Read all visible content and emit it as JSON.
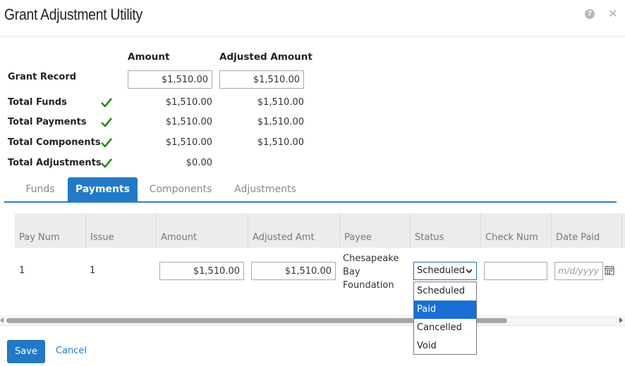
{
  "window": {
    "title": "Grant Adjustment Utility"
  },
  "summary": {
    "amount_header": "Amount",
    "adjusted_header": "Adjusted Amount",
    "grant_record_label": "Grant Record",
    "grant_record_amount": "$1,510.00",
    "grant_record_adjusted": "$1,510.00",
    "rows": [
      {
        "label": "Total Funds",
        "amount": "$1,510.00",
        "adjusted": "$1,510.00"
      },
      {
        "label": "Total Payments",
        "amount": "$1,510.00",
        "adjusted": "$1,510.00"
      },
      {
        "label": "Total Components",
        "amount": "$1,510.00",
        "adjusted": "$1,510.00"
      },
      {
        "label": "Total Adjustments",
        "amount": "$0.00",
        "adjusted": ""
      }
    ]
  },
  "tabs": [
    {
      "label": "Funds",
      "active": false
    },
    {
      "label": "Payments",
      "active": true
    },
    {
      "label": "Components",
      "active": false
    },
    {
      "label": "Adjustments",
      "active": false
    }
  ],
  "grid": {
    "columns": [
      "Pay Num",
      "Issue",
      "Amount",
      "Adjusted Amt",
      "Payee",
      "Status",
      "Check Num",
      "Date Paid"
    ],
    "row": {
      "pay_num": "1",
      "issue": "1",
      "amount": "$1,510.00",
      "adjusted_amt": "$1,510.00",
      "payee": [
        "Chesapeake",
        "Bay",
        "Foundation"
      ],
      "status": "Scheduled",
      "check_num": "",
      "date_placeholder": "m/d/yyyy"
    }
  },
  "status_options": [
    "Scheduled",
    "Paid",
    "Cancelled",
    "Void"
  ],
  "status_highlighted": "Paid",
  "footer": {
    "save_label": "Save",
    "cancel_label": "Cancel"
  },
  "colors": {
    "primary": "#2379c6",
    "check": "#2a8a1f",
    "highlight": "#1a6fd6"
  },
  "icons": {
    "help": "help-icon",
    "close": "close-icon",
    "check": "check-icon",
    "calendar": "calendar-icon"
  }
}
